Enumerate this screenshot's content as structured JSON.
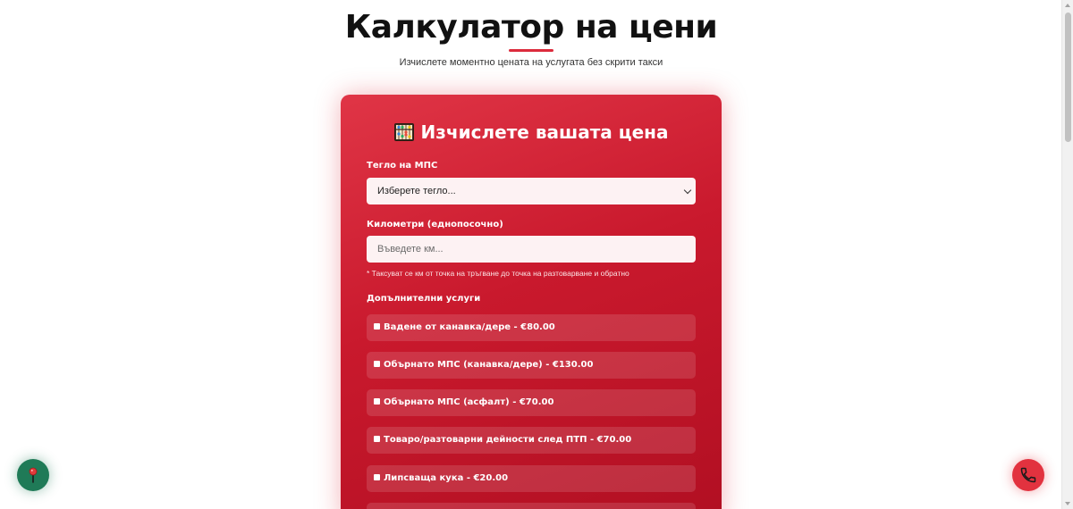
{
  "header": {
    "title": "Калкулатор на цени",
    "subtitle": "Изчислете моментно цената на услугата без скрити такси"
  },
  "calculator": {
    "heading": "Изчислете вашата цена",
    "heading_icon": "abacus-icon",
    "weight": {
      "label": "Тегло на МПС",
      "selected": "Изберете тегло..."
    },
    "km": {
      "label": "Километри (еднопосочно)",
      "placeholder": "Въведете км...",
      "note": "* Таксуват се км от точка на тръгване до точка на разтоварване и обратно"
    },
    "services": {
      "label": "Допълнителни услуги",
      "items": [
        {
          "label": "Вадене от канавка/дере - €80.00"
        },
        {
          "label": "Обърнато МПС (канавка/дере) - €130.00"
        },
        {
          "label": "Обърнато МПС (асфалт) - €70.00"
        },
        {
          "label": "Товаро/разтоварни дейности след ПТП - €70.00"
        },
        {
          "label": "Липсваща кука - €20.00"
        }
      ]
    }
  },
  "floating": {
    "left_icon": "map-pin-icon",
    "right_icon": "phone-icon"
  },
  "colors": {
    "accent": "#dc2b3c",
    "card_top": "#e03546",
    "card_bottom": "#b10f22",
    "map_button": "#1f7a57",
    "phone_button": "#e2323f"
  }
}
